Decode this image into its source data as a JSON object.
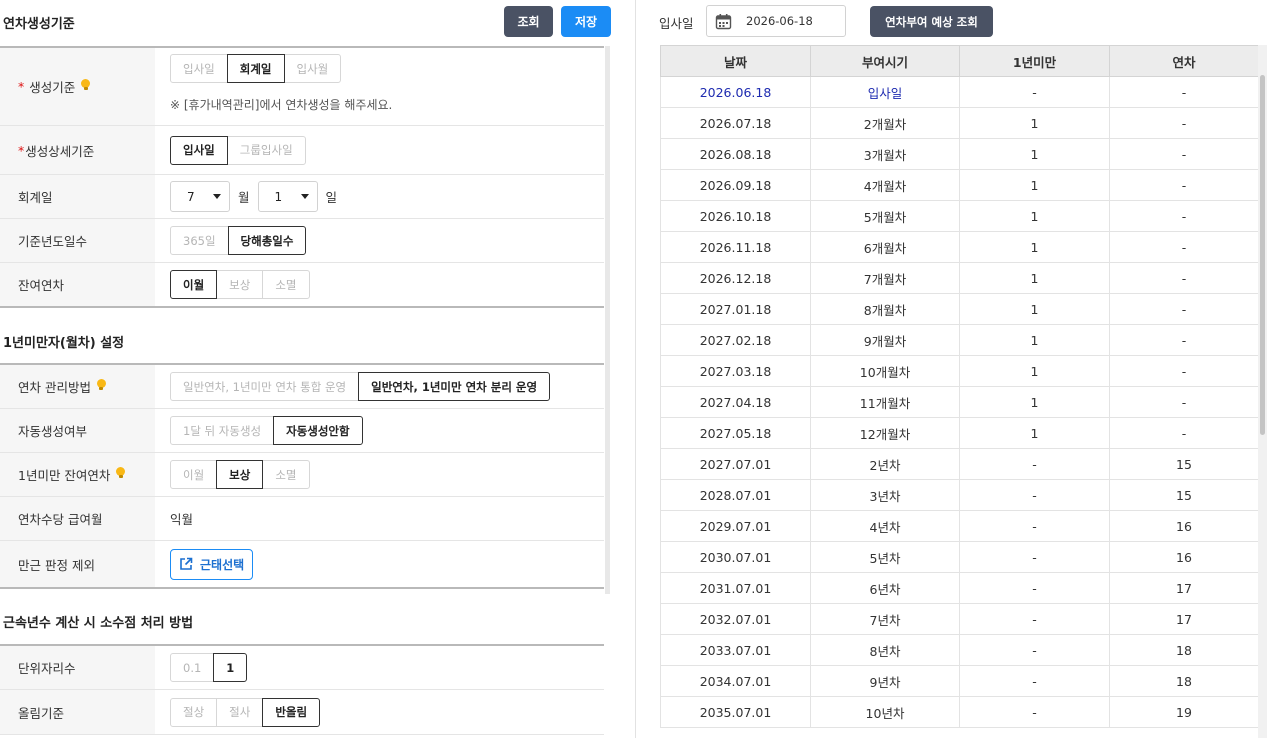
{
  "header": {
    "title": "연차생성기준",
    "search_label": "조회",
    "save_label": "저장"
  },
  "section1": {
    "rows": [
      {
        "label": "생성기준",
        "required": "*",
        "options": [
          "입사일",
          "회계일",
          "입사월"
        ],
        "selected": "회계일",
        "note": "※ [휴가내역관리]에서 연차생성을 해주세요."
      },
      {
        "label": "생성상세기준",
        "required": "*",
        "options": [
          "입사일",
          "그룹입사일"
        ],
        "selected": "입사일"
      },
      {
        "label": "회계일",
        "month_value": "7",
        "month_unit": "월",
        "day_value": "1",
        "day_unit": "일"
      },
      {
        "label": "기준년도일수",
        "options": [
          "365일",
          "당해총일수"
        ],
        "selected": "당해총일수"
      },
      {
        "label": "잔여연차",
        "options": [
          "이월",
          "보상",
          "소멸"
        ],
        "selected": "이월"
      }
    ]
  },
  "section2": {
    "title": "1년미만자(월차) 설정",
    "rows": [
      {
        "label": "연차 관리방법",
        "options": [
          "일반연차, 1년미만 연차 통합 운영",
          "일반연차, 1년미만 연차 분리 운영"
        ],
        "selected": "일반연차, 1년미만 연차 분리 운영"
      },
      {
        "label": "자동생성여부",
        "options": [
          "1달 뒤 자동생성",
          "자동생성안함"
        ],
        "selected": "자동생성안함"
      },
      {
        "label": "1년미만 잔여연차",
        "options": [
          "이월",
          "보상",
          "소멸"
        ],
        "selected": "보상"
      },
      {
        "label": "연차수당 급여월",
        "value": "익월"
      },
      {
        "label": "만근 판정 제외",
        "button_label": "근태선택"
      }
    ]
  },
  "section3": {
    "title": "근속년수 계산 시 소수점 처리 방법",
    "rows": [
      {
        "label": "단위자리수",
        "options": [
          "0.1",
          "1"
        ],
        "selected": "1"
      },
      {
        "label": "올림기준",
        "options": [
          "절상",
          "절사",
          "반올림"
        ],
        "selected": "반올림"
      }
    ]
  },
  "preview": {
    "date_label": "입사일",
    "date_value": "2026-06-18",
    "button_label": "연차부여 예상 조회",
    "columns": [
      "날짜",
      "부여시기",
      "1년미만",
      "연차"
    ],
    "rows": [
      [
        "2026.06.18",
        "입사일",
        "-",
        "-"
      ],
      [
        "2026.07.18",
        "2개월차",
        "1",
        "-"
      ],
      [
        "2026.08.18",
        "3개월차",
        "1",
        "-"
      ],
      [
        "2026.09.18",
        "4개월차",
        "1",
        "-"
      ],
      [
        "2026.10.18",
        "5개월차",
        "1",
        "-"
      ],
      [
        "2026.11.18",
        "6개월차",
        "1",
        "-"
      ],
      [
        "2026.12.18",
        "7개월차",
        "1",
        "-"
      ],
      [
        "2027.01.18",
        "8개월차",
        "1",
        "-"
      ],
      [
        "2027.02.18",
        "9개월차",
        "1",
        "-"
      ],
      [
        "2027.03.18",
        "10개월차",
        "1",
        "-"
      ],
      [
        "2027.04.18",
        "11개월차",
        "1",
        "-"
      ],
      [
        "2027.05.18",
        "12개월차",
        "1",
        "-"
      ],
      [
        "2027.07.01",
        "2년차",
        "-",
        "15"
      ],
      [
        "2028.07.01",
        "3년차",
        "-",
        "15"
      ],
      [
        "2029.07.01",
        "4년차",
        "-",
        "16"
      ],
      [
        "2030.07.01",
        "5년차",
        "-",
        "16"
      ],
      [
        "2031.07.01",
        "6년차",
        "-",
        "17"
      ],
      [
        "2032.07.01",
        "7년차",
        "-",
        "17"
      ],
      [
        "2033.07.01",
        "8년차",
        "-",
        "18"
      ],
      [
        "2034.07.01",
        "9년차",
        "-",
        "18"
      ],
      [
        "2035.07.01",
        "10년차",
        "-",
        "19"
      ]
    ]
  },
  "colors": {
    "primary_blue": "#1b8cf5",
    "dark_button": "#4a5264",
    "highlight_text": "#1e2bb0",
    "required_mark": "#dd1111"
  }
}
